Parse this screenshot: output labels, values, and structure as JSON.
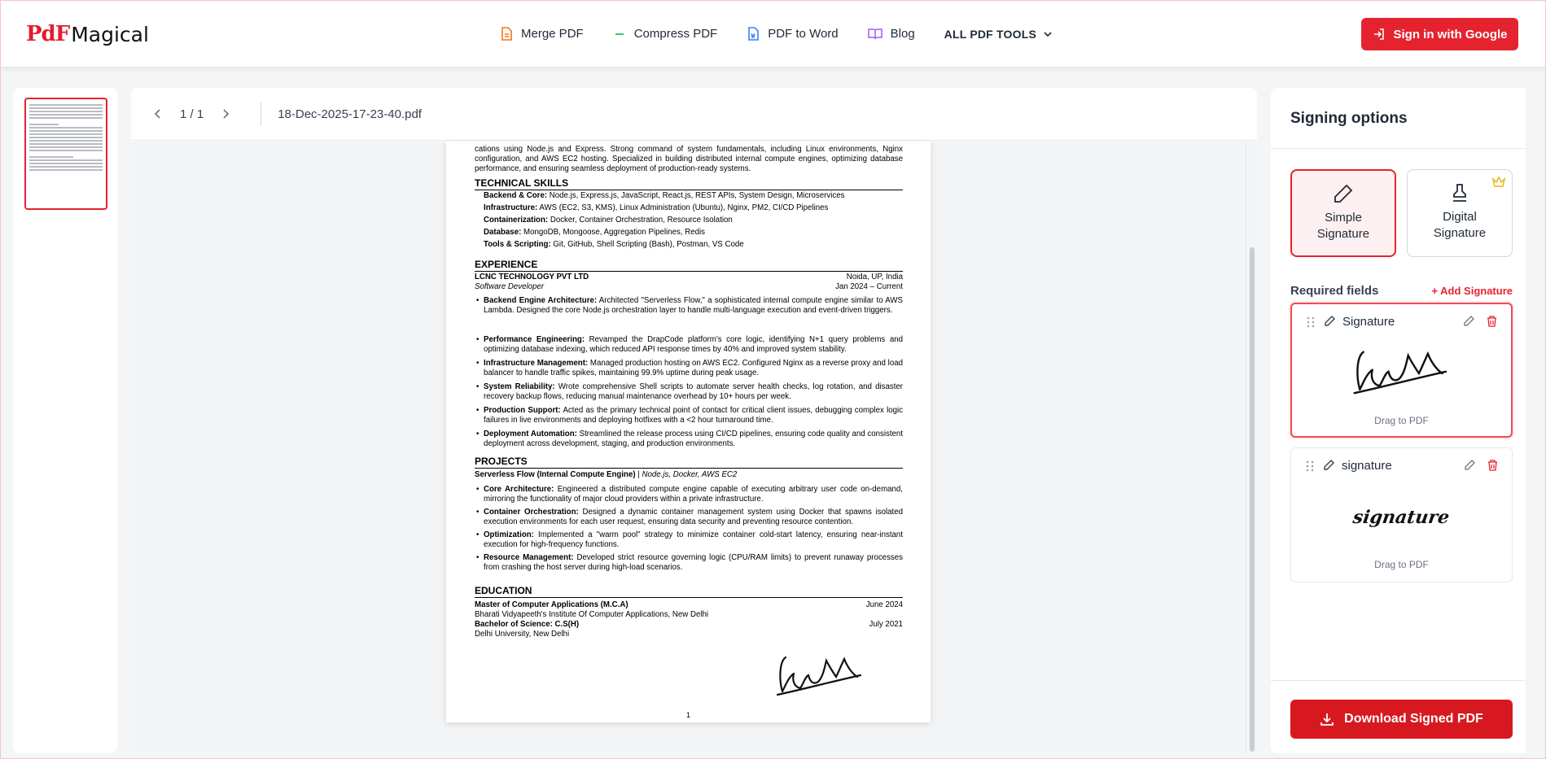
{
  "header": {
    "logo_pdf": "PdF",
    "logo_text": "Magical",
    "nav": [
      {
        "label": "Merge PDF",
        "icon": "document-icon",
        "color": "#f97316"
      },
      {
        "label": "Compress PDF",
        "icon": "minus-icon",
        "color": "#22c55e"
      },
      {
        "label": "PDF to Word",
        "icon": "word-file-icon",
        "color": "#3b82f6"
      },
      {
        "label": "Blog",
        "icon": "book-icon",
        "color": "#a855f7"
      }
    ],
    "all_tools": "ALL PDF TOOLS",
    "sign_in": "Sign in with Google",
    "accent": "#e5232f"
  },
  "viewer": {
    "page_indicator": "1 / 1",
    "file_name": "18-Dec-2025-17-23-40.pdf"
  },
  "resume": {
    "intro": "cations using Node.js and Express. Strong command of system fundamentals, including Linux environments, Nginx configuration, and AWS EC2 hosting. Specialized in building distributed internal compute engines, optimizing database performance, and ensuring seamless deployment of production-ready systems.",
    "skills_title": "TECHNICAL SKILLS",
    "skills": [
      {
        "k": "Backend & Core:",
        "v": " Node.js, Express.js, JavaScript, React.js, REST APIs, System Design, Microservices"
      },
      {
        "k": "Infrastructure:",
        "v": " AWS (EC2, S3, KMS), Linux Administration (Ubuntu), Nginx, PM2, CI/CD Pipelines"
      },
      {
        "k": "Containerization:",
        "v": " Docker, Container Orchestration, Resource Isolation"
      },
      {
        "k": "Database:",
        "v": " MongoDB, Mongoose, Aggregation Pipelines, Redis"
      },
      {
        "k": "Tools & Scripting:",
        "v": " Git, GitHub, Shell Scripting (Bash), Postman, VS Code"
      }
    ],
    "exp_title": "EXPERIENCE",
    "company": "LCNC TECHNOLOGY PVT LTD",
    "location": "Noida, UP, India",
    "role": "Software Developer",
    "dates": "Jan 2024 – Current",
    "exp_bullets": [
      {
        "k": "Backend Engine Architecture:",
        "v": " Architected \"Serverless Flow,\" a sophisticated internal compute engine similar to AWS Lambda. Designed the core Node.js orchestration layer to handle multi-language execution and event-driven triggers."
      },
      {
        "k": "Performance Engineering:",
        "v": " Revamped the DrapCode platform's core logic, identifying N+1 query problems and optimizing database indexing, which reduced API response times by 40% and improved system stability."
      },
      {
        "k": "Infrastructure Management:",
        "v": " Managed production hosting on AWS EC2. Configured Nginx as a reverse proxy and load balancer to handle traffic spikes, maintaining 99.9% uptime during peak usage."
      },
      {
        "k": "System Reliability:",
        "v": " Wrote comprehensive Shell scripts to automate server health checks, log rotation, and disaster recovery backup flows, reducing manual maintenance overhead by 10+ hours per week."
      },
      {
        "k": "Production Support:",
        "v": " Acted as the primary technical point of contact for critical client issues, debugging complex logic failures in live environments and deploying hotfixes with a <2 hour turnaround time."
      },
      {
        "k": "Deployment Automation:",
        "v": " Streamlined the release process using CI/CD pipelines, ensuring code quality and consistent deployment across development, staging, and production environments."
      }
    ],
    "proj_title": "PROJECTS",
    "proj_name": "Serverless Flow (Internal Compute Engine)",
    "proj_stack": "Node.js, Docker, AWS EC2",
    "proj_bullets": [
      {
        "k": "Core Architecture:",
        "v": " Engineered a distributed compute engine capable of executing arbitrary user code on-demand, mirroring the functionality of major cloud providers within a private infrastructure."
      },
      {
        "k": "Container Orchestration:",
        "v": " Designed a dynamic container management system using Docker that spawns isolated execution environments for each user request, ensuring data security and preventing resource contention."
      },
      {
        "k": "Optimization:",
        "v": " Implemented a \"warm pool\" strategy to minimize container cold-start latency, ensuring near-instant execution for high-frequency functions."
      },
      {
        "k": "Resource Management:",
        "v": " Developed strict resource governing logic (CPU/RAM limits) to prevent runaway processes from crashing the host server during high-load scenarios."
      }
    ],
    "edu_title": "EDUCATION",
    "edu": [
      {
        "deg": "Master of Computer Applications (M.C.A)",
        "date": "June 2024",
        "school": "Bharati Vidyapeeth's Institute Of Computer Applications, New Delhi"
      },
      {
        "deg": "Bachelor of Science: C.S(H)",
        "date": "July 2021",
        "school": "Delhi University, New Delhi"
      }
    ],
    "page_number": "1"
  },
  "panel": {
    "title": "Signing options",
    "option_simple": "Simple Signature",
    "option_digital": "Digital Signature",
    "required_fields": "Required fields",
    "add_signature": "+ Add Signature",
    "signatures": [
      {
        "name": "Signature",
        "hint": "Drag to PDF"
      },
      {
        "name": "signature",
        "typed": "signature",
        "hint": "Drag to PDF"
      }
    ],
    "download": "Download Signed PDF"
  }
}
